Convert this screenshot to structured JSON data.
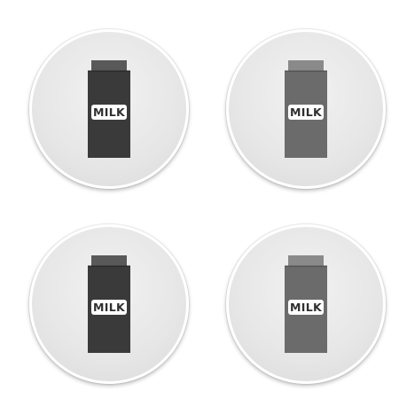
{
  "icons": [
    {
      "label": "MILK",
      "body_color": "#3a3a3a",
      "cap_color": "#595959",
      "icon": "milk-carton-icon"
    },
    {
      "label": "MILK",
      "body_color": "#6b6b6b",
      "cap_color": "#8a8a8a",
      "icon": "milk-carton-icon"
    },
    {
      "label": "MILK",
      "body_color": "#3a3a3a",
      "cap_color": "#595959",
      "icon": "milk-carton-icon"
    },
    {
      "label": "MILK",
      "body_color": "#6b6b6b",
      "cap_color": "#8a8a8a",
      "icon": "milk-carton-icon"
    }
  ],
  "label_text_color": "#2f2f2f",
  "label_bg_color": "#ffffff"
}
